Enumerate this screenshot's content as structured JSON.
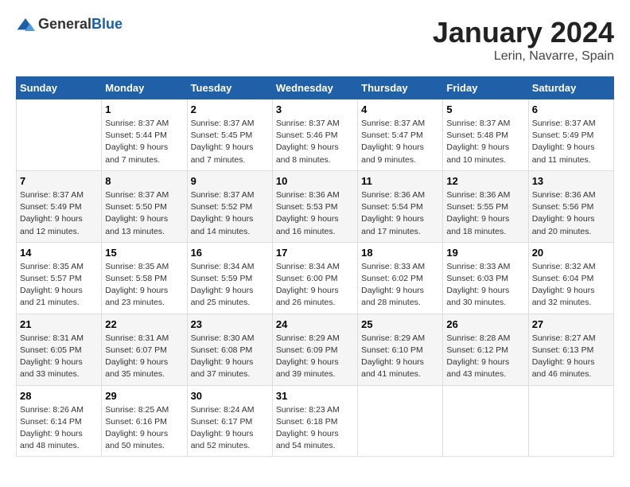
{
  "logo": {
    "general": "General",
    "blue": "Blue"
  },
  "header": {
    "month": "January 2024",
    "location": "Lerin, Navarre, Spain"
  },
  "weekdays": [
    "Sunday",
    "Monday",
    "Tuesday",
    "Wednesday",
    "Thursday",
    "Friday",
    "Saturday"
  ],
  "weeks": [
    [
      {
        "day": "",
        "info": ""
      },
      {
        "day": "1",
        "info": "Sunrise: 8:37 AM\nSunset: 5:44 PM\nDaylight: 9 hours\nand 7 minutes."
      },
      {
        "day": "2",
        "info": "Sunrise: 8:37 AM\nSunset: 5:45 PM\nDaylight: 9 hours\nand 7 minutes."
      },
      {
        "day": "3",
        "info": "Sunrise: 8:37 AM\nSunset: 5:46 PM\nDaylight: 9 hours\nand 8 minutes."
      },
      {
        "day": "4",
        "info": "Sunrise: 8:37 AM\nSunset: 5:47 PM\nDaylight: 9 hours\nand 9 minutes."
      },
      {
        "day": "5",
        "info": "Sunrise: 8:37 AM\nSunset: 5:48 PM\nDaylight: 9 hours\nand 10 minutes."
      },
      {
        "day": "6",
        "info": "Sunrise: 8:37 AM\nSunset: 5:49 PM\nDaylight: 9 hours\nand 11 minutes."
      }
    ],
    [
      {
        "day": "7",
        "info": "Sunrise: 8:37 AM\nSunset: 5:49 PM\nDaylight: 9 hours\nand 12 minutes."
      },
      {
        "day": "8",
        "info": "Sunrise: 8:37 AM\nSunset: 5:50 PM\nDaylight: 9 hours\nand 13 minutes."
      },
      {
        "day": "9",
        "info": "Sunrise: 8:37 AM\nSunset: 5:52 PM\nDaylight: 9 hours\nand 14 minutes."
      },
      {
        "day": "10",
        "info": "Sunrise: 8:36 AM\nSunset: 5:53 PM\nDaylight: 9 hours\nand 16 minutes."
      },
      {
        "day": "11",
        "info": "Sunrise: 8:36 AM\nSunset: 5:54 PM\nDaylight: 9 hours\nand 17 minutes."
      },
      {
        "day": "12",
        "info": "Sunrise: 8:36 AM\nSunset: 5:55 PM\nDaylight: 9 hours\nand 18 minutes."
      },
      {
        "day": "13",
        "info": "Sunrise: 8:36 AM\nSunset: 5:56 PM\nDaylight: 9 hours\nand 20 minutes."
      }
    ],
    [
      {
        "day": "14",
        "info": "Sunrise: 8:35 AM\nSunset: 5:57 PM\nDaylight: 9 hours\nand 21 minutes."
      },
      {
        "day": "15",
        "info": "Sunrise: 8:35 AM\nSunset: 5:58 PM\nDaylight: 9 hours\nand 23 minutes."
      },
      {
        "day": "16",
        "info": "Sunrise: 8:34 AM\nSunset: 5:59 PM\nDaylight: 9 hours\nand 25 minutes."
      },
      {
        "day": "17",
        "info": "Sunrise: 8:34 AM\nSunset: 6:00 PM\nDaylight: 9 hours\nand 26 minutes."
      },
      {
        "day": "18",
        "info": "Sunrise: 8:33 AM\nSunset: 6:02 PM\nDaylight: 9 hours\nand 28 minutes."
      },
      {
        "day": "19",
        "info": "Sunrise: 8:33 AM\nSunset: 6:03 PM\nDaylight: 9 hours\nand 30 minutes."
      },
      {
        "day": "20",
        "info": "Sunrise: 8:32 AM\nSunset: 6:04 PM\nDaylight: 9 hours\nand 32 minutes."
      }
    ],
    [
      {
        "day": "21",
        "info": "Sunrise: 8:31 AM\nSunset: 6:05 PM\nDaylight: 9 hours\nand 33 minutes."
      },
      {
        "day": "22",
        "info": "Sunrise: 8:31 AM\nSunset: 6:07 PM\nDaylight: 9 hours\nand 35 minutes."
      },
      {
        "day": "23",
        "info": "Sunrise: 8:30 AM\nSunset: 6:08 PM\nDaylight: 9 hours\nand 37 minutes."
      },
      {
        "day": "24",
        "info": "Sunrise: 8:29 AM\nSunset: 6:09 PM\nDaylight: 9 hours\nand 39 minutes."
      },
      {
        "day": "25",
        "info": "Sunrise: 8:29 AM\nSunset: 6:10 PM\nDaylight: 9 hours\nand 41 minutes."
      },
      {
        "day": "26",
        "info": "Sunrise: 8:28 AM\nSunset: 6:12 PM\nDaylight: 9 hours\nand 43 minutes."
      },
      {
        "day": "27",
        "info": "Sunrise: 8:27 AM\nSunset: 6:13 PM\nDaylight: 9 hours\nand 46 minutes."
      }
    ],
    [
      {
        "day": "28",
        "info": "Sunrise: 8:26 AM\nSunset: 6:14 PM\nDaylight: 9 hours\nand 48 minutes."
      },
      {
        "day": "29",
        "info": "Sunrise: 8:25 AM\nSunset: 6:16 PM\nDaylight: 9 hours\nand 50 minutes."
      },
      {
        "day": "30",
        "info": "Sunrise: 8:24 AM\nSunset: 6:17 PM\nDaylight: 9 hours\nand 52 minutes."
      },
      {
        "day": "31",
        "info": "Sunrise: 8:23 AM\nSunset: 6:18 PM\nDaylight: 9 hours\nand 54 minutes."
      },
      {
        "day": "",
        "info": ""
      },
      {
        "day": "",
        "info": ""
      },
      {
        "day": "",
        "info": ""
      }
    ]
  ]
}
